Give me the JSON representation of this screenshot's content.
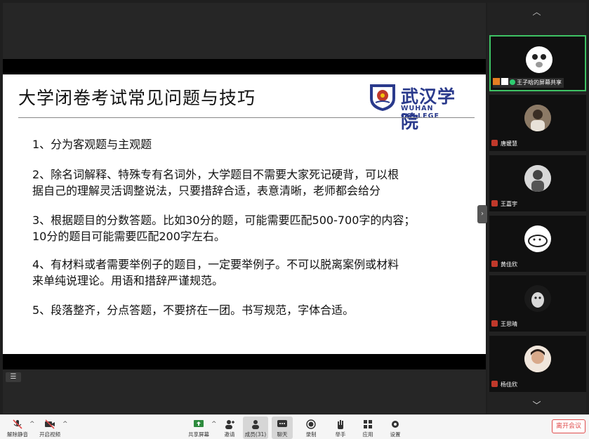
{
  "slide": {
    "title": "大学闭卷考试常见问题与技巧",
    "logo_cn": "武汉学院",
    "logo_en": "WUHAN COLLEGE",
    "points": [
      {
        "line1": "1、分为客观题与主观题",
        "line2": ""
      },
      {
        "line1": "2、除名词解释、特殊专有名词外，大学题目不需要大家死记硬背，可以根",
        "line2": "据自己的理解灵活调整说法，只要措辞合适，表意清晰，老师都会给分"
      },
      {
        "line1": "3、根据题目的分数答题。比如30分的题，可能需要匹配500-700字的内容；",
        "line2": "10分的题目可能需要匹配200字左右。"
      },
      {
        "line1": "4、有材料或者需要举例子的题目，一定要举例子。不可以脱离案例或材料",
        "line2": "来单纯说理论。用语和措辞严谨规范。"
      },
      {
        "line1": "5、段落整齐，分点答题，不要挤在一团。书写规范，字体合适。",
        "line2": ""
      }
    ]
  },
  "panel": {
    "up_icon": "chevron-up",
    "down_icon": "chevron-down",
    "participants": [
      {
        "name": "王子晗的屏幕共享",
        "avatar_icon": "cartoon-face",
        "sharing": true
      },
      {
        "name": "唐媛慧",
        "avatar_icon": "person-photo"
      },
      {
        "name": "王嘉宇",
        "avatar_icon": "person-photo"
      },
      {
        "name": "黄佳欣",
        "avatar_icon": "cartoon-seal"
      },
      {
        "name": "王思晴",
        "avatar_icon": "cat-photo"
      },
      {
        "name": "杨佳欣",
        "avatar_icon": "person-photo"
      }
    ]
  },
  "toolbar": {
    "mute": "解除静音",
    "video": "开启视频",
    "share": "共享屏幕",
    "invite": "邀请",
    "members": "成员(31)",
    "chat": "聊天",
    "record": "录制",
    "raise_hand": "举手",
    "apps": "应用",
    "settings": "设置",
    "leave": "离开会议"
  },
  "colors": {
    "active_border": "#3ec264",
    "leave_red": "#e04b4b",
    "logo_blue": "#2a3a8c",
    "mic_muted": "#c0392b"
  }
}
